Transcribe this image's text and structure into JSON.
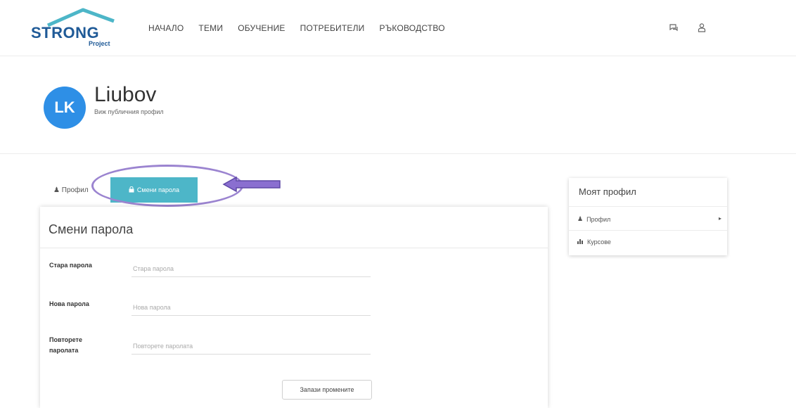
{
  "header": {
    "logo_text": "STRONG",
    "logo_sub": "Project",
    "nav": [
      "НАЧАЛО",
      "ТЕМИ",
      "ОБУЧЕНИЕ",
      "ПОТРЕБИТЕЛИ",
      "РЪКОВОДСТВО"
    ],
    "icons": [
      "chat-icon",
      "user-icon"
    ]
  },
  "profile": {
    "initials": "LK",
    "name": "Liubov",
    "sub": "Виж публичния профил"
  },
  "tabs": {
    "profile_label": "Профил",
    "password_label": "Смени парола"
  },
  "form": {
    "title": "Смени парола",
    "fields": [
      {
        "label": "Старa парола",
        "placeholder": "Стара парола"
      },
      {
        "label": "Нова парола",
        "placeholder": "Нова парола"
      },
      {
        "label": "Повторете паролата",
        "placeholder": "Повторете паролата"
      }
    ],
    "save_label": "Запази промените"
  },
  "sidebar": {
    "title": "Моят профил",
    "items": [
      {
        "label": "Профил",
        "icon": "user-icon"
      },
      {
        "label": "Курсове",
        "icon": "bar-chart-icon"
      }
    ]
  },
  "colors": {
    "accent": "#4db6c8",
    "avatar": "#2e8fe6",
    "brand": "#1f5a97",
    "annotation": "#8a6fd0"
  }
}
